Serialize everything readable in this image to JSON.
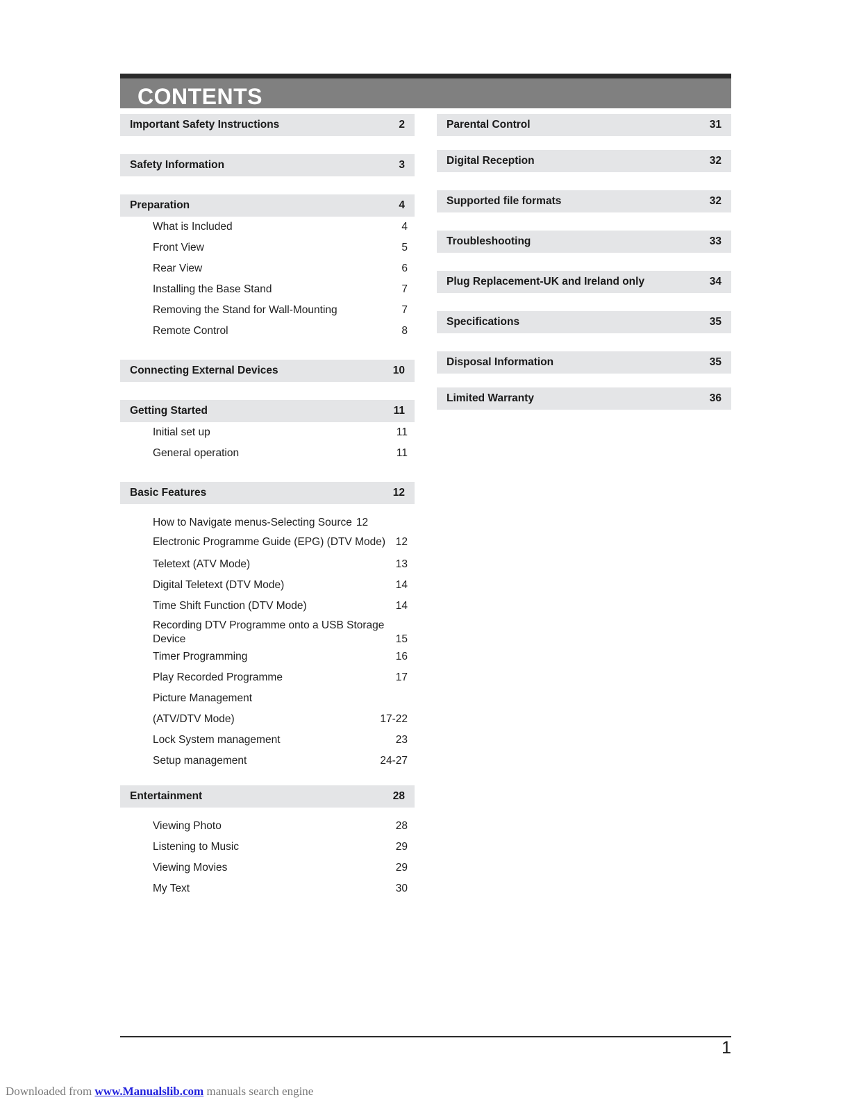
{
  "document": {
    "header_title": "CONTENTS",
    "page_number": "1"
  },
  "left_column": [
    {
      "kind": "section",
      "label": "Important Safety Instructions",
      "page": "2"
    },
    {
      "kind": "section",
      "label": "Safety Information",
      "page": "3"
    },
    {
      "kind": "section",
      "label": "Preparation",
      "page": "4"
    },
    {
      "kind": "sub",
      "label": "What is Included",
      "page": "4"
    },
    {
      "kind": "sub",
      "label": "Front View",
      "page": "5"
    },
    {
      "kind": "sub",
      "label": "Rear View",
      "page": "6"
    },
    {
      "kind": "sub",
      "label": "Installing the Base Stand",
      "page": "7"
    },
    {
      "kind": "sub",
      "label": "Removing the Stand for Wall-Mounting",
      "page": "7"
    },
    {
      "kind": "sub",
      "label": "Remote Control",
      "page": "8"
    },
    {
      "kind": "section",
      "label": "Connecting External Devices",
      "page": "10"
    },
    {
      "kind": "section",
      "label": "Getting Started",
      "page": "11"
    },
    {
      "kind": "sub",
      "label": "Initial set up",
      "page": "11"
    },
    {
      "kind": "sub",
      "label": "General operation",
      "page": "11"
    },
    {
      "kind": "section",
      "label": "Basic Features",
      "page": "12"
    },
    {
      "kind": "sub",
      "label": "How to Navigate menus-Selecting Source",
      "page": "12"
    },
    {
      "kind": "sub",
      "label": "Electronic Programme Guide (EPG) (DTV Mode)",
      "page": "12"
    },
    {
      "kind": "sub",
      "label": "Teletext (ATV Mode)",
      "page": "13"
    },
    {
      "kind": "sub",
      "label": "Digital Teletext (DTV Mode)",
      "page": "14"
    },
    {
      "kind": "sub",
      "label": "Time Shift Function (DTV Mode)",
      "page": "14"
    },
    {
      "kind": "sub",
      "label": "Recording DTV Programme onto a USB Storage Device",
      "page": "15"
    },
    {
      "kind": "sub",
      "label": "Timer Programming",
      "page": "16"
    },
    {
      "kind": "sub",
      "label": "Play Recorded Programme",
      "page": "17"
    },
    {
      "kind": "sub",
      "label": "Picture Management",
      "page": ""
    },
    {
      "kind": "sub",
      "label": "(ATV/DTV Mode)",
      "page": "17-22"
    },
    {
      "kind": "sub",
      "label": "Lock System management",
      "page": "23"
    },
    {
      "kind": "sub",
      "label": "Setup management",
      "page": "24-27"
    },
    {
      "kind": "section",
      "label": "Entertainment",
      "page": "28"
    },
    {
      "kind": "sub",
      "label": "Viewing Photo",
      "page": "28"
    },
    {
      "kind": "sub",
      "label": "Listening to Music",
      "page": "29"
    },
    {
      "kind": "sub",
      "label": "Viewing Movies",
      "page": "29"
    },
    {
      "kind": "sub",
      "label": "My Text",
      "page": "30"
    }
  ],
  "right_column": [
    {
      "kind": "section",
      "label": "Parental Control",
      "page": "31"
    },
    {
      "kind": "section",
      "label": "Digital Reception",
      "page": "32"
    },
    {
      "kind": "section",
      "label": "Supported file formats",
      "page": "32"
    },
    {
      "kind": "section",
      "label": "Troubleshooting",
      "page": "33"
    },
    {
      "kind": "section",
      "label": "Plug Replacement-UK and Ireland only",
      "page": "34"
    },
    {
      "kind": "section",
      "label": "Specifications",
      "page": "35"
    },
    {
      "kind": "section",
      "label": "Disposal Information",
      "page": "35"
    },
    {
      "kind": "section",
      "label": "Limited Warranty",
      "page": "36"
    }
  ],
  "watermark": {
    "prefix": "Downloaded from ",
    "link": "www.Manualslib.com",
    "suffix": " manuals search engine"
  }
}
